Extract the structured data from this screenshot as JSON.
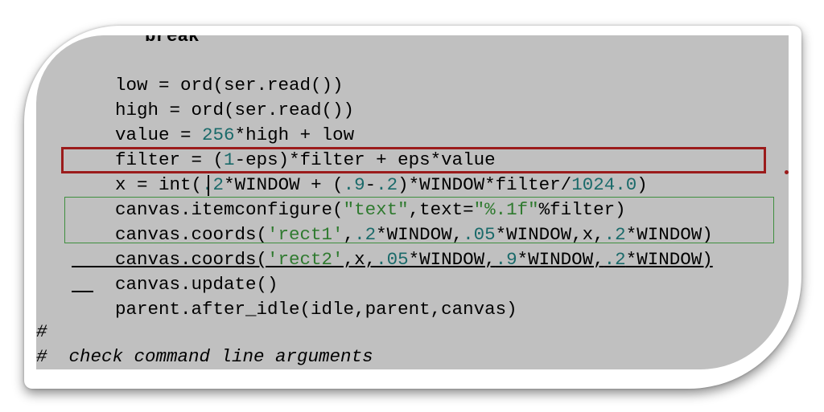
{
  "code": {
    "line_partial_top": "break",
    "line_low": [
      "low = ord(ser.read())"
    ],
    "line_high": [
      "high = ord(ser.read())"
    ],
    "line_value": [
      "value = ",
      "256",
      "*high + low"
    ],
    "line_filter": [
      "filter = (",
      "1",
      "-eps)*filter + eps*value"
    ],
    "line_x": [
      "x = int(",
      ".2",
      "*WINDOW + (",
      ".9",
      "-",
      ".2",
      ")*WINDOW*filter/",
      "1024.0",
      ")"
    ],
    "line_itemconfigure": [
      "canvas.itemconfigure(",
      "\"text\"",
      ",text=",
      "\"%.1f\"",
      "%filter)"
    ],
    "line_rect1": [
      "canvas.coords(",
      "'rect1'",
      ",",
      ".2",
      "*WINDOW,",
      ".05",
      "*WINDOW,x,",
      ".2",
      "*WINDOW)"
    ],
    "line_rect2": [
      "canvas.coords(",
      "'rect2'",
      ",x,",
      ".05",
      "*WINDOW,",
      ".9",
      "*WINDOW,",
      ".2",
      "*WINDOW)"
    ],
    "line_update": [
      "canvas.update()"
    ],
    "line_after_idle": [
      "parent.after_idle(idle,parent,canvas)"
    ],
    "comment_hash": "#",
    "comment_check": "#  check command line arguments"
  },
  "colors": {
    "panel_background": "#c0c0c0",
    "number": "#1a6a6a",
    "string": "#2f7a2f",
    "highlight_red": "#9b1b1b",
    "highlight_green": "#3f8f3f"
  }
}
